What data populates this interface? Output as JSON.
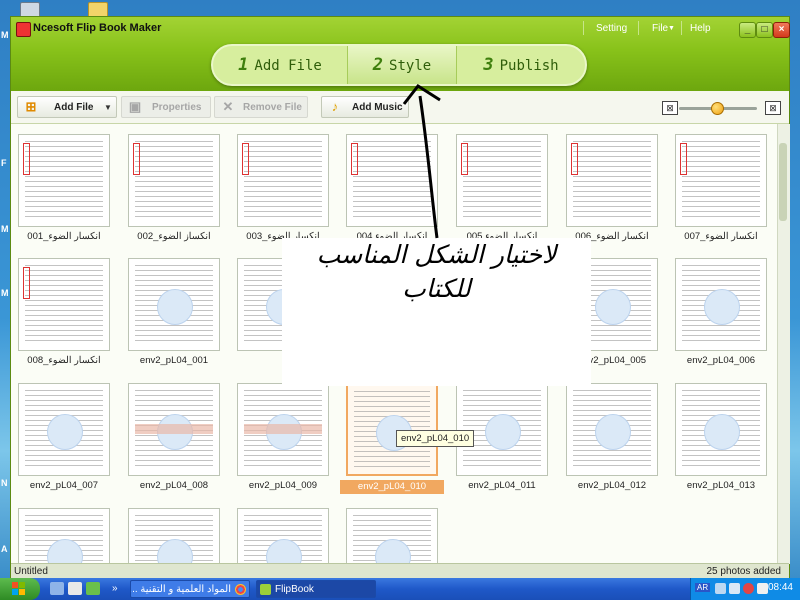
{
  "app": {
    "title": "Ncesoft Flip Book Maker",
    "menu": [
      "Setting",
      "File",
      "Help"
    ],
    "window_buttons": {
      "minimize": "_",
      "maximize": "□",
      "close": "×"
    }
  },
  "steps": [
    {
      "num": "1",
      "label": "Add File"
    },
    {
      "num": "2",
      "label": "Style",
      "active": true
    },
    {
      "num": "3",
      "label": "Publish"
    }
  ],
  "toolbar": {
    "add_file": "Add File",
    "properties": "Properties",
    "remove_file": "Remove File",
    "add_music": "Add Music"
  },
  "zoom_percent": 50,
  "thumbnails": [
    {
      "label": "انكسار الضوء_001"
    },
    {
      "label": "انكساز الضوء_002"
    },
    {
      "label": "انكسار الضوء_003"
    },
    {
      "label": "انكسار الضوء 004"
    },
    {
      "label": "انكسار الضوء 005"
    },
    {
      "label": "انكسار الضوء_006"
    },
    {
      "label": "انكسار الضوء_007"
    },
    {
      "label": "انكسار الضوء_008"
    },
    {
      "label": "env2_pL04_001"
    },
    {
      "label": ""
    },
    {
      "label": ""
    },
    {
      "label": ""
    },
    {
      "label": "env2_pL04_005"
    },
    {
      "label": "env2_pL04_006"
    },
    {
      "label": "env2_pL04_007"
    },
    {
      "label": "env2_pL04_008"
    },
    {
      "label": "env2_pL04_009"
    },
    {
      "label": "env2_pL04_010",
      "selected": true
    },
    {
      "label": "env2_pL04_011"
    },
    {
      "label": "env2_pL04_012"
    },
    {
      "label": "env2_pL04_013"
    },
    {
      "label": ""
    },
    {
      "label": ""
    },
    {
      "label": ""
    },
    {
      "label": ""
    }
  ],
  "tooltip": "env2_pL04_010",
  "annotation": {
    "text": "لاختيار الشكل  المناسب للكتاب"
  },
  "status": {
    "left": "Untitled",
    "right": "25 photos added"
  },
  "taskbar": {
    "tasks": [
      "المواد العلمية و التقنية ...",
      "FlipBook"
    ],
    "tray_lang": "AR",
    "clock": "08:44"
  },
  "desktop_side_letters": [
    "M",
    "F",
    "M",
    "M",
    "N",
    "A"
  ],
  "colors": {
    "accent": "#88c21a",
    "selection": "#f1a860",
    "annotation_ink": "#000000"
  }
}
